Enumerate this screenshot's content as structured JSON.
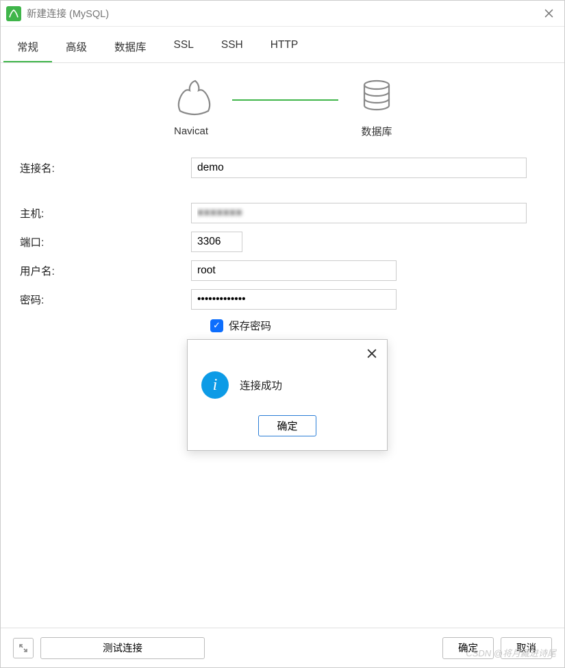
{
  "window": {
    "title": "新建连接 (MySQL)"
  },
  "tabs": {
    "items": [
      {
        "label": "常规"
      },
      {
        "label": "高级"
      },
      {
        "label": "数据库"
      },
      {
        "label": "SSL"
      },
      {
        "label": "SSH"
      },
      {
        "label": "HTTP"
      }
    ],
    "active_index": 0
  },
  "illustration": {
    "left_label": "Navicat",
    "right_label": "数据库"
  },
  "form": {
    "connection_name": {
      "label": "连接名:",
      "value": "demo"
    },
    "host": {
      "label": "主机:",
      "value": "■■■■■■■"
    },
    "port": {
      "label": "端口:",
      "value": "3306"
    },
    "username": {
      "label": "用户名:",
      "value": "root"
    },
    "password": {
      "label": "密码:",
      "value": "●●●●●●●●●●●●●"
    },
    "save_password": {
      "label": "保存密码",
      "checked": true
    }
  },
  "modal": {
    "message": "连接成功",
    "ok": "确定"
  },
  "footer": {
    "test": "测试连接",
    "ok": "确定",
    "cancel": "取消"
  },
  "watermark": "CSDN @将月藏进诗尾"
}
